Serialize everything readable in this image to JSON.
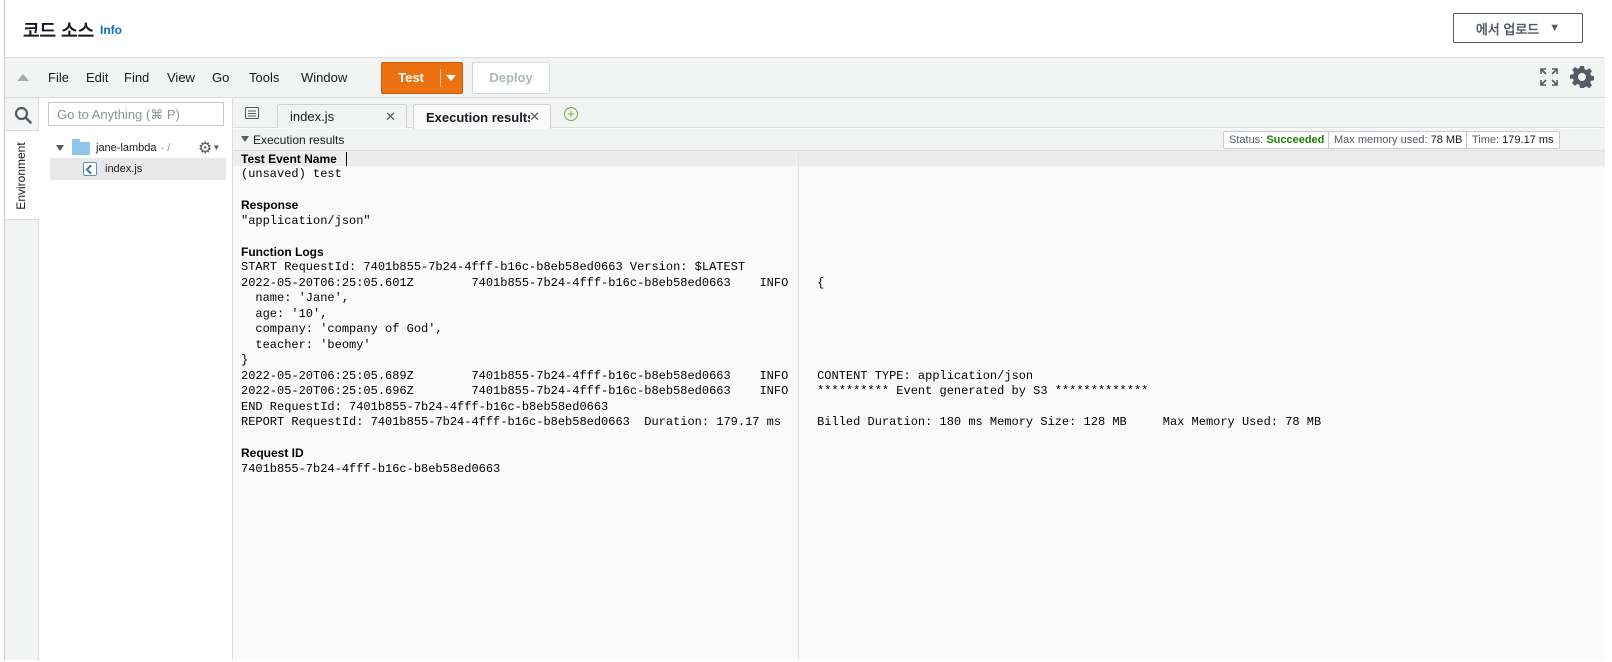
{
  "header": {
    "title": "코드 소스",
    "info_label": "Info",
    "upload_label": "에서 업로드"
  },
  "menubar": {
    "items": [
      "File",
      "Edit",
      "Find",
      "View",
      "Go",
      "Tools",
      "Window"
    ],
    "test_label": "Test",
    "deploy_label": "Deploy"
  },
  "sidebar": {
    "environment_label": "Environment",
    "goto_placeholder": "Go to Anything (⌘ P)",
    "root_folder": "jane-lambda",
    "root_suffix": "- /",
    "file": "index.js"
  },
  "tabs": [
    {
      "label": "index.js"
    },
    {
      "label": "Execution results"
    }
  ],
  "results": {
    "section_label": "Execution results",
    "status_label": "Status:",
    "status_value": "Succeeded",
    "memory_label": "Max memory used:",
    "memory_value": "78 MB",
    "time_label": "Time:",
    "time_value": "179.17 ms"
  },
  "output": {
    "test_event_heading": "Test Event Name",
    "test_event_value": "(unsaved) test",
    "response_heading": "Response",
    "response_value": "\"application/json\"",
    "function_logs_heading": "Function Logs",
    "log_lines": [
      "START RequestId: 7401b855-7b24-4fff-b16c-b8eb58ed0663 Version: $LATEST",
      "2022-05-20T06:25:05.601Z\t7401b855-7b24-4fff-b16c-b8eb58ed0663\tINFO\t{",
      "  name: 'Jane',",
      "  age: '10',",
      "  company: 'company of God',",
      "  teacher: 'beomy'",
      "}",
      "2022-05-20T06:25:05.689Z\t7401b855-7b24-4fff-b16c-b8eb58ed0663\tINFO\tCONTENT TYPE: application/json",
      "2022-05-20T06:25:05.696Z\t7401b855-7b24-4fff-b16c-b8eb58ed0663\tINFO\t********** Event generated by S3 *************",
      "END RequestId: 7401b855-7b24-4fff-b16c-b8eb58ed0663",
      "REPORT RequestId: 7401b855-7b24-4fff-b16c-b8eb58ed0663\tDuration: 179.17 ms\tBilled Duration: 180 ms\tMemory Size: 128 MB\tMax Memory Used: 78 MB\t"
    ],
    "request_id_heading": "Request ID",
    "request_id_value": "7401b855-7b24-4fff-b16c-b8eb58ed0663"
  },
  "colors": {
    "accent": "#ec7211",
    "link": "#0073bb",
    "success": "#1d8102"
  }
}
